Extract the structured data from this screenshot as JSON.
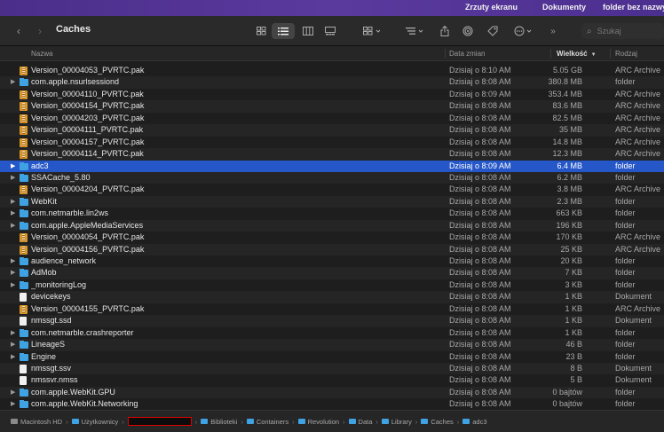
{
  "menubar": {
    "items": [
      "Zrzuty ekranu",
      "Dokumenty",
      "folder bez nazwy"
    ]
  },
  "toolbar": {
    "title": "Caches",
    "back_icon": "chevron-left-icon",
    "forward_icon": "chevron-right-icon",
    "search_placeholder": "Szukaj"
  },
  "columns": {
    "name": "Nazwa",
    "date": "Data zmian",
    "size": "Wielkość",
    "kind": "Rodzaj"
  },
  "files": [
    {
      "name": "Version_00004053_PVRTC.pak",
      "date": "Dzisiaj o 8:10 AM",
      "size": "5.05 GB",
      "kind": "ARC Archive",
      "icon": "pak",
      "folder": false
    },
    {
      "name": "com.apple.nsurlsessiond",
      "date": "Dzisiaj o 8:08 AM",
      "size": "380.8 MB",
      "kind": "folder",
      "icon": "folder",
      "folder": true
    },
    {
      "name": "Version_00004110_PVRTC.pak",
      "date": "Dzisiaj o 8:09 AM",
      "size": "353.4 MB",
      "kind": "ARC Archive",
      "icon": "pak",
      "folder": false
    },
    {
      "name": "Version_00004154_PVRTC.pak",
      "date": "Dzisiaj o 8:08 AM",
      "size": "83.6 MB",
      "kind": "ARC Archive",
      "icon": "pak",
      "folder": false
    },
    {
      "name": "Version_00004203_PVRTC.pak",
      "date": "Dzisiaj o 8:08 AM",
      "size": "82.5 MB",
      "kind": "ARC Archive",
      "icon": "pak",
      "folder": false
    },
    {
      "name": "Version_00004111_PVRTC.pak",
      "date": "Dzisiaj o 8:08 AM",
      "size": "35 MB",
      "kind": "ARC Archive",
      "icon": "pak",
      "folder": false
    },
    {
      "name": "Version_00004157_PVRTC.pak",
      "date": "Dzisiaj o 8:08 AM",
      "size": "14.8 MB",
      "kind": "ARC Archive",
      "icon": "pak",
      "folder": false
    },
    {
      "name": "Version_00004114_PVRTC.pak",
      "date": "Dzisiaj o 8:08 AM",
      "size": "12.3 MB",
      "kind": "ARC Archive",
      "icon": "pak",
      "folder": false
    },
    {
      "name": "adc3",
      "date": "Dzisiaj o 8:09 AM",
      "size": "6.4 MB",
      "kind": "folder",
      "icon": "folder",
      "folder": true,
      "selected": true
    },
    {
      "name": "SSACache_5.80",
      "date": "Dzisiaj o 8:08 AM",
      "size": "6.2 MB",
      "kind": "folder",
      "icon": "folder",
      "folder": true
    },
    {
      "name": "Version_00004204_PVRTC.pak",
      "date": "Dzisiaj o 8:08 AM",
      "size": "3.8 MB",
      "kind": "ARC Archive",
      "icon": "pak",
      "folder": false
    },
    {
      "name": "WebKit",
      "date": "Dzisiaj o 8:08 AM",
      "size": "2.3 MB",
      "kind": "folder",
      "icon": "folder",
      "folder": true
    },
    {
      "name": "com.netmarble.lin2ws",
      "date": "Dzisiaj o 8:08 AM",
      "size": "663 KB",
      "kind": "folder",
      "icon": "folder",
      "folder": true
    },
    {
      "name": "com.apple.AppleMediaServices",
      "date": "Dzisiaj o 8:08 AM",
      "size": "196 KB",
      "kind": "folder",
      "icon": "folder",
      "folder": true
    },
    {
      "name": "Version_00004054_PVRTC.pak",
      "date": "Dzisiaj o 8:08 AM",
      "size": "170 KB",
      "kind": "ARC Archive",
      "icon": "pak",
      "folder": false
    },
    {
      "name": "Version_00004156_PVRTC.pak",
      "date": "Dzisiaj o 8:08 AM",
      "size": "25 KB",
      "kind": "ARC Archive",
      "icon": "pak",
      "folder": false
    },
    {
      "name": "audience_network",
      "date": "Dzisiaj o 8:08 AM",
      "size": "20 KB",
      "kind": "folder",
      "icon": "folder",
      "folder": true
    },
    {
      "name": "AdMob",
      "date": "Dzisiaj o 8:08 AM",
      "size": "7 KB",
      "kind": "folder",
      "icon": "folder",
      "folder": true
    },
    {
      "name": "_monitoringLog",
      "date": "Dzisiaj o 8:08 AM",
      "size": "3 KB",
      "kind": "folder",
      "icon": "folder",
      "folder": true
    },
    {
      "name": "devicekeys",
      "date": "Dzisiaj o 8:08 AM",
      "size": "1 KB",
      "kind": "Dokument",
      "icon": "doc",
      "folder": false
    },
    {
      "name": "Version_00004155_PVRTC.pak",
      "date": "Dzisiaj o 8:08 AM",
      "size": "1 KB",
      "kind": "ARC Archive",
      "icon": "pak",
      "folder": false
    },
    {
      "name": "nmssgt.ssd",
      "date": "Dzisiaj o 8:08 AM",
      "size": "1 KB",
      "kind": "Dokument",
      "icon": "doc",
      "folder": false
    },
    {
      "name": "com.netmarble.crashreporter",
      "date": "Dzisiaj o 8:08 AM",
      "size": "1 KB",
      "kind": "folder",
      "icon": "folder",
      "folder": true
    },
    {
      "name": "LineageS",
      "date": "Dzisiaj o 8:08 AM",
      "size": "46 B",
      "kind": "folder",
      "icon": "folder",
      "folder": true
    },
    {
      "name": "Engine",
      "date": "Dzisiaj o 8:08 AM",
      "size": "23 B",
      "kind": "folder",
      "icon": "folder",
      "folder": true
    },
    {
      "name": "nmssgt.ssv",
      "date": "Dzisiaj o 8:08 AM",
      "size": "8 B",
      "kind": "Dokument",
      "icon": "doc",
      "folder": false
    },
    {
      "name": "nmssvr.nmss",
      "date": "Dzisiaj o 8:08 AM",
      "size": "5 B",
      "kind": "Dokument",
      "icon": "doc",
      "folder": false
    },
    {
      "name": "com.apple.WebKit.GPU",
      "date": "Dzisiaj o 8:08 AM",
      "size": "0 bajtów",
      "kind": "folder",
      "icon": "folder",
      "folder": true
    },
    {
      "name": "com.apple.WebKit.Networking",
      "date": "Dzisiaj o 8:08 AM",
      "size": "0 bajtów",
      "kind": "folder",
      "icon": "folder",
      "folder": true
    }
  ],
  "pathbar": {
    "items": [
      "Macintosh HD",
      "Użytkownicy",
      "",
      "Biblioteki",
      "Containers",
      "Revolution",
      "Data",
      "Library",
      "Caches",
      "adc3"
    ]
  },
  "colors": {
    "selection": "#2657c8",
    "folder": "#3fa2e3",
    "pak": "#d8962a"
  }
}
